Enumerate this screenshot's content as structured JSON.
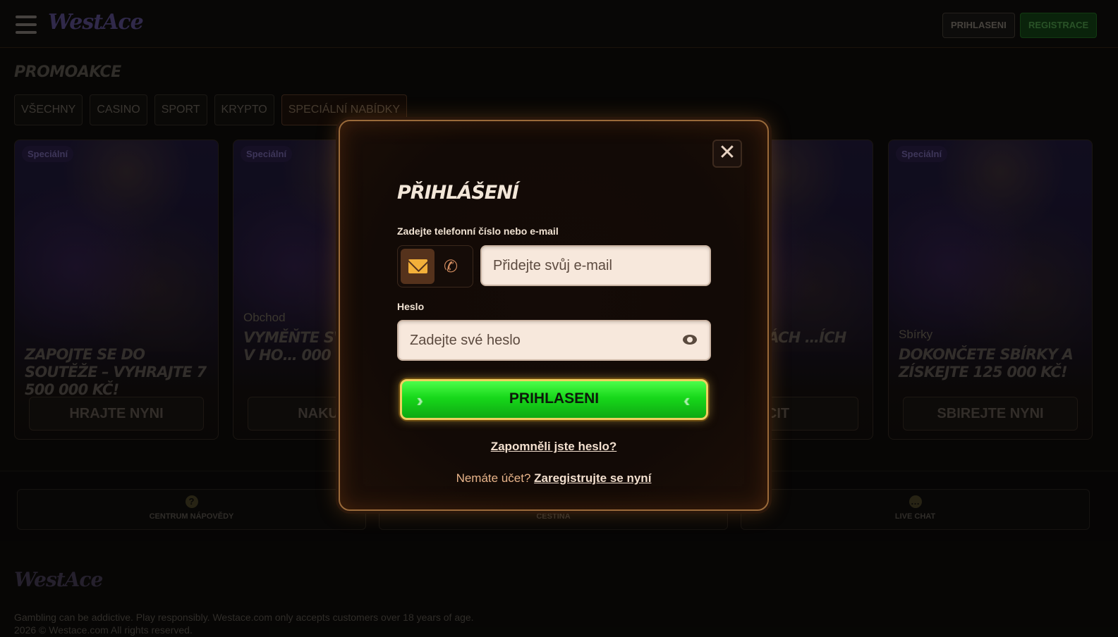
{
  "header": {
    "logo": "WestAce",
    "login_label": "PRIHLASENI",
    "register_label": "REGISTRACE"
  },
  "promo": {
    "title": "PROMOAKCE",
    "tabs": [
      "VŠECHNY",
      "CASINO",
      "SPORT",
      "KRYPTO",
      "SPECIÁLNÍ NABÍDKY"
    ],
    "cards": [
      {
        "badge": "Speciální",
        "category": "",
        "title": "ZAPOJTE SE DO SOUTĚŽE – VYHRAJTE 7 500 000 KČ!",
        "button": "HRAJTE NYNI"
      },
      {
        "badge": "Speciální",
        "category": "Obchod",
        "title": "VYMĚŇTE SVÉ ODMĚNY V HO… 000 KČ!",
        "button": "NAKUPU…"
      },
      {
        "badge": "",
        "category": "",
        "title": "…Y ODMĚNÁCH …ÍCH",
        "button": "…CIT"
      },
      {
        "badge": "Speciální",
        "category": "Sbírky",
        "title": "DOKONČETE SBÍRKY A ZÍSKEJTE 125 000 KČ!",
        "button": "SBIREJTE NYNI"
      }
    ]
  },
  "support": {
    "items": [
      {
        "label": "CENTRUM NÁPOVĚDY",
        "icon": "question-icon"
      },
      {
        "label": "ČEŠTINA",
        "icon": "language-icon"
      },
      {
        "label": "LIVE CHAT",
        "icon": "chat-icon"
      }
    ]
  },
  "footer": {
    "logo": "WestAce",
    "disclaimer": "Gambling can be addictive. Play responsibly. Westace.com only accepts customers over 18 years of age.",
    "copyright": "2026 © Westace.com All rights reserved."
  },
  "modal": {
    "title": "PŘIHLÁŠENÍ",
    "identity_label": "Zadejte telefonní číslo nebo e-mail",
    "email_placeholder": "Přidejte svůj e-mail",
    "password_label": "Heslo",
    "password_placeholder": "Zadejte své heslo",
    "login_button": "PRIHLASENI",
    "forgot_link": "Zapomněli jste heslo?",
    "no_account_text": "Nemáte účet?",
    "register_link": "Zaregistrujte se nyní",
    "close_icon": "✕",
    "accent_color": "#1bd81d",
    "border_color": "#9a6a3a"
  }
}
